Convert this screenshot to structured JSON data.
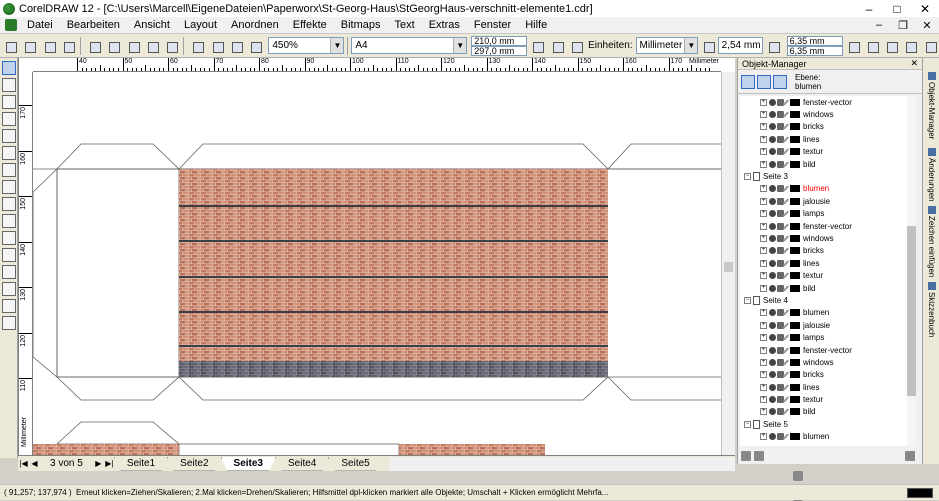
{
  "window": {
    "title": "CorelDRAW 12 - [C:\\Users\\Marcell\\EigeneDateien\\Paperworx\\St-Georg-Haus\\StGeorgHaus-verschnitt-elemente1.cdr]",
    "controls": [
      "–",
      "□",
      "✕"
    ]
  },
  "menu": {
    "items": [
      "Datei",
      "Bearbeiten",
      "Ansicht",
      "Layout",
      "Anordnen",
      "Effekte",
      "Bitmaps",
      "Text",
      "Extras",
      "Fenster",
      "Hilfe"
    ],
    "underlines": [
      "D",
      "B",
      "A",
      "L",
      "A",
      "E",
      "B",
      "T",
      "x",
      "F",
      "H"
    ],
    "mdi_controls": [
      "–",
      "❐",
      "✕"
    ]
  },
  "toolbar": {
    "zoom": "450%",
    "paper": "A4",
    "width": "210,0 mm",
    "height": "297,0 mm",
    "units_label": "Einheiten:",
    "units": "Millimeter",
    "nudge": "2,54 mm",
    "dup_x": "6,35 mm",
    "dup_y": "6,35 mm"
  },
  "rulers": {
    "h_unit": "Millimeter",
    "h_numbers": [
      "40",
      "50",
      "60",
      "70",
      "80",
      "90",
      "100",
      "110",
      "120",
      "130",
      "140",
      "150",
      "160",
      "170"
    ],
    "v_numbers": [
      "170",
      "160",
      "150",
      "140",
      "130",
      "120",
      "110"
    ],
    "v_unit": "Millimeter"
  },
  "pages": {
    "counter": "3 von 5",
    "tabs": [
      "Seite1",
      "Seite2",
      "Seite3",
      "Seite4",
      "Seite5"
    ],
    "active": "Seite3"
  },
  "status": {
    "coords": "( 91,257; 137,974 )",
    "hint": "Erneut klicken=Ziehen/Skalieren; 2.Mal klicken=Drehen/Skalieren; Hilfsmittel dpl-klicken markiert alle Objekte; Umschalt + Klicken ermöglicht Mehrfa..."
  },
  "object_manager": {
    "title": "Objekt-Manager",
    "layer_label": "Ebene:",
    "layer_name": "blumen",
    "rows": [
      {
        "type": "layer",
        "name": "fenster-vector",
        "red": false
      },
      {
        "type": "layer",
        "name": "windows",
        "red": false
      },
      {
        "type": "layer",
        "name": "bricks",
        "red": false
      },
      {
        "type": "layer",
        "name": "lines",
        "red": false
      },
      {
        "type": "layer",
        "name": "textur",
        "red": false
      },
      {
        "type": "layer",
        "name": "bild",
        "red": false
      },
      {
        "type": "page",
        "name": "Seite 3"
      },
      {
        "type": "layer",
        "name": "blumen",
        "red": true
      },
      {
        "type": "layer",
        "name": "jalousie",
        "red": false
      },
      {
        "type": "layer",
        "name": "lamps",
        "red": false
      },
      {
        "type": "layer",
        "name": "fenster-vector",
        "red": false
      },
      {
        "type": "layer",
        "name": "windows",
        "red": false
      },
      {
        "type": "layer",
        "name": "bricks",
        "red": false
      },
      {
        "type": "layer",
        "name": "lines",
        "red": false
      },
      {
        "type": "layer",
        "name": "textur",
        "red": false
      },
      {
        "type": "layer",
        "name": "bild",
        "red": false
      },
      {
        "type": "page",
        "name": "Seite 4"
      },
      {
        "type": "layer",
        "name": "blumen",
        "red": false
      },
      {
        "type": "layer",
        "name": "jalousie",
        "red": false
      },
      {
        "type": "layer",
        "name": "lamps",
        "red": false
      },
      {
        "type": "layer",
        "name": "fenster-vector",
        "red": false
      },
      {
        "type": "layer",
        "name": "windows",
        "red": false
      },
      {
        "type": "layer",
        "name": "bricks",
        "red": false
      },
      {
        "type": "layer",
        "name": "lines",
        "red": false
      },
      {
        "type": "layer",
        "name": "textur",
        "red": false
      },
      {
        "type": "layer",
        "name": "bild",
        "red": false
      },
      {
        "type": "page",
        "name": "Seite 5"
      },
      {
        "type": "layer",
        "name": "blumen",
        "red": false
      }
    ]
  },
  "side_tabs": [
    "Objekt-Manager",
    "Änderungen",
    "Zeichen einfügen",
    "Skizzenbuch"
  ],
  "colors": {
    "brick": "#c8826a",
    "mortar": "#e8d8cc",
    "dark_stripe": "#4a4a52",
    "accent": "#316ac5"
  }
}
